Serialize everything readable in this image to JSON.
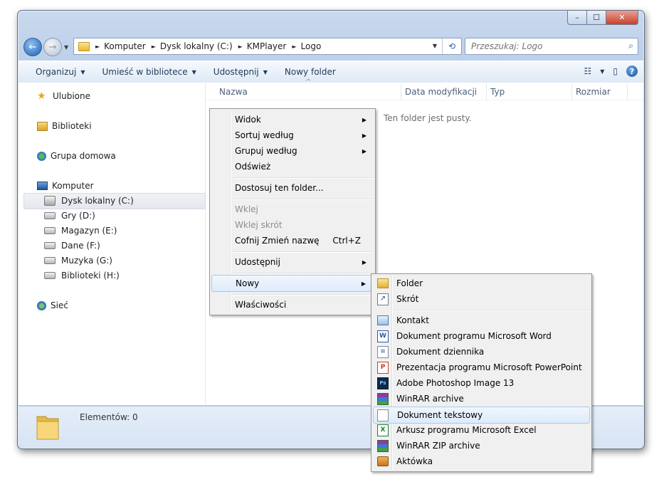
{
  "window": {
    "minimize": "–",
    "maximize": "☐",
    "close": "✕"
  },
  "nav": {
    "back": "←",
    "forward": "→",
    "history_dropdown": "▼"
  },
  "breadcrumb": [
    "Komputer",
    "Dysk lokalny (C:)",
    "KMPlayer",
    "Logo"
  ],
  "breadcrumb_sep": "►",
  "address_dropdown": "▼",
  "refresh_icon": "⟲",
  "search": {
    "placeholder": "Przeszukaj: Logo",
    "icon": "⌕"
  },
  "toolbar": {
    "organize": "Organizuj",
    "library": "Umieść w bibliotece",
    "share": "Udostępnij",
    "new_folder": "Nowy folder",
    "dropdown": "▼",
    "views_icon": "☷",
    "preview_icon": "▯",
    "help": "?"
  },
  "navpane": {
    "favorites": "Ulubione",
    "libraries": "Biblioteki",
    "homegroup": "Grupa domowa",
    "computer": "Komputer",
    "drives": [
      "Dysk lokalny (C:)",
      "Gry (D:)",
      "Magazyn (E:)",
      "Dane (F:)",
      "Muzyka (G:)",
      "Biblioteki (H:)"
    ],
    "network": "Sieć"
  },
  "columns": {
    "name": "Nazwa",
    "sort_arrow": "^",
    "date": "Data modyfikacji",
    "type": "Typ",
    "size": "Rozmiar"
  },
  "content": {
    "empty_text": "Ten folder jest pusty."
  },
  "status": {
    "items": "Elementów: 0"
  },
  "context_menu": {
    "items": [
      {
        "label": "Widok",
        "submenu_arrow": "▶"
      },
      {
        "label": "Sortuj według",
        "submenu_arrow": "▶"
      },
      {
        "label": "Grupuj według",
        "submenu_arrow": "▶"
      },
      {
        "label": "Odśwież"
      },
      {
        "label": "Dostosuj ten folder..."
      },
      {
        "label": "Wklej",
        "disabled": true
      },
      {
        "label": "Wklej skrót",
        "disabled": true
      },
      {
        "label": "Cofnij Zmień nazwę",
        "shortcut": "Ctrl+Z"
      },
      {
        "label": "Udostępnij",
        "submenu_arrow": "▶"
      },
      {
        "label": "Nowy",
        "submenu_arrow": "▶",
        "highlighted": true
      },
      {
        "label": "Właściwości"
      }
    ]
  },
  "new_submenu": {
    "items": [
      {
        "label": "Folder",
        "icon": "folder-icon"
      },
      {
        "label": "Skrót",
        "icon": "shortcut-icon"
      },
      {
        "label": "Kontakt",
        "icon": "contact-icon"
      },
      {
        "label": "Dokument programu Microsoft Word",
        "icon": "word-icon"
      },
      {
        "label": "Dokument dziennika",
        "icon": "journal-icon"
      },
      {
        "label": "Prezentacja programu Microsoft PowerPoint",
        "icon": "powerpoint-icon"
      },
      {
        "label": "Adobe Photoshop Image 13",
        "icon": "photoshop-icon"
      },
      {
        "label": "WinRAR archive",
        "icon": "winrar-icon"
      },
      {
        "label": "Dokument tekstowy",
        "icon": "text-document-icon",
        "highlighted": true
      },
      {
        "label": "Arkusz programu Microsoft Excel",
        "icon": "excel-icon"
      },
      {
        "label": "WinRAR ZIP archive",
        "icon": "winrar-zip-icon"
      },
      {
        "label": "Aktówka",
        "icon": "briefcase-icon"
      }
    ]
  },
  "colors": {
    "accent": "#1e395b",
    "selection": "#dcebfc",
    "window_frame": "#bcd0ea"
  }
}
